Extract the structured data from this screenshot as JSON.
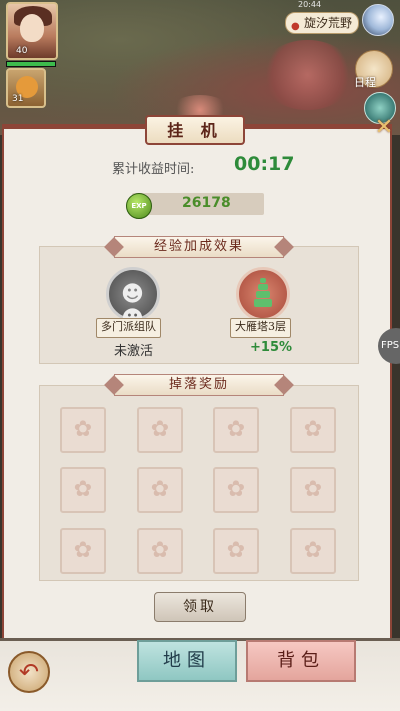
{
  "hud": {
    "player_level": "40",
    "pet_level": "31",
    "location": "旋汐荒野",
    "clock": "20:44",
    "schedule_label": "日程",
    "hp_fraction": 1.0
  },
  "panel": {
    "title": "挂 机",
    "earn_label": "累计收益时间:",
    "earn_time": "00:17",
    "exp_icon_label": "EXP",
    "exp_value": "26178"
  },
  "bonus": {
    "title": "经验加成效果",
    "items": [
      {
        "name": "多门派组队",
        "status": "未激活"
      },
      {
        "name": "大雁塔3层",
        "status": "+15%"
      }
    ]
  },
  "drops": {
    "title": "掉落奖励",
    "slot_count": 12
  },
  "claim_label": "领取",
  "bottom": {
    "map_label": "地图",
    "bag_label": "背包"
  },
  "fps_label": "FPS"
}
